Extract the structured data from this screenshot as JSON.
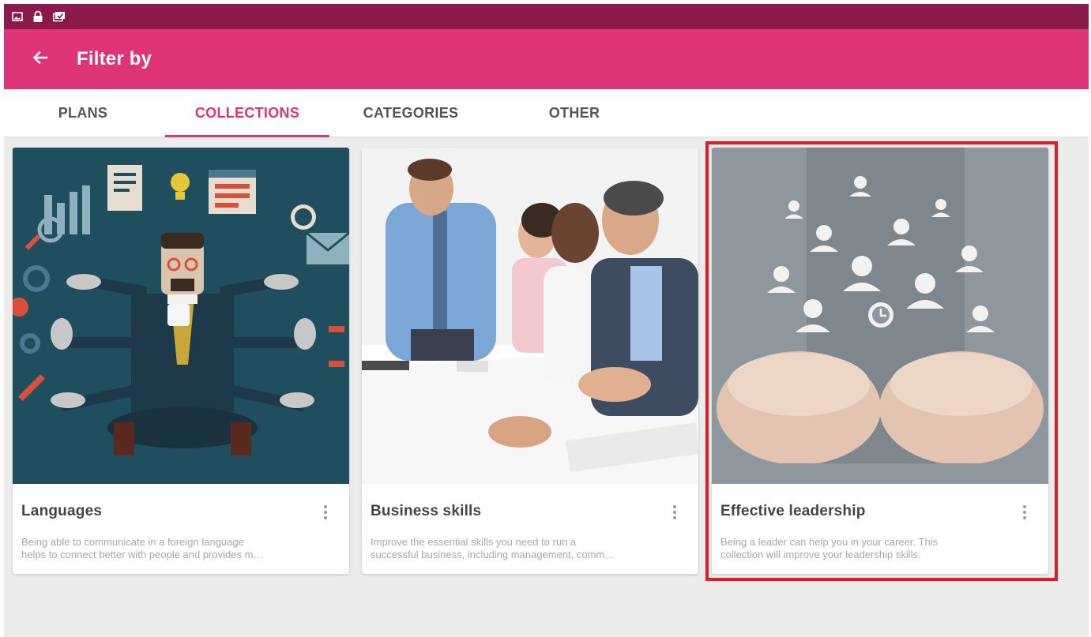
{
  "status_bar": {
    "icons": [
      "image-icon",
      "lock-icon",
      "notification-icon"
    ]
  },
  "app_bar": {
    "back_icon": "arrow-left-icon",
    "title": "Filter by"
  },
  "tabs": [
    {
      "label": "PLANS",
      "active": false
    },
    {
      "label": "COLLECTIONS",
      "active": true
    },
    {
      "label": "CATEGORIES",
      "active": false
    },
    {
      "label": "OTHER",
      "active": false
    }
  ],
  "cards": [
    {
      "title": "Languages",
      "desc_line1": "Being able to communicate in a foreign language",
      "desc_line2": "helps to connect better with people and provides m…",
      "menu_icon": "more-vert-icon",
      "highlighted": false
    },
    {
      "title": "Business skills",
      "desc_line1": "Improve the essential skills you need to run a",
      "desc_line2": "successful business, including management, comm…",
      "menu_icon": "more-vert-icon",
      "highlighted": false
    },
    {
      "title": "Effective leadership",
      "desc_line1": "Being a leader can help you in your career. This",
      "desc_line2": "collection will improve your leadership skills.",
      "menu_icon": "more-vert-icon",
      "highlighted": true
    }
  ],
  "colors": {
    "status_bar": "#8a1a4a",
    "accent": "#de3478",
    "highlight": "#e01b24",
    "background": "#ececec"
  }
}
